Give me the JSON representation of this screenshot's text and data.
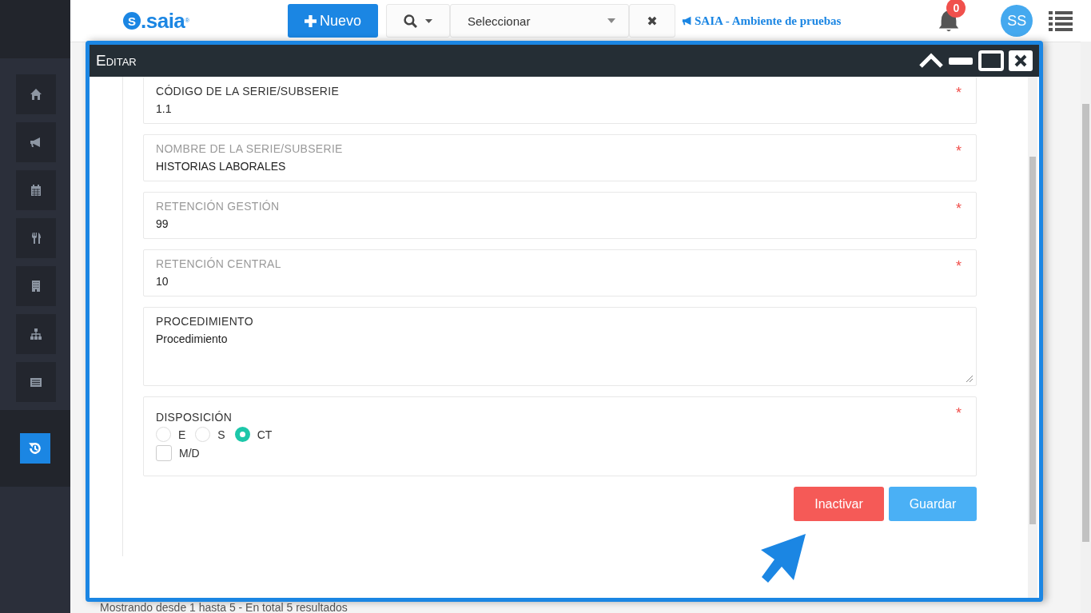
{
  "header": {
    "logo": {
      "badge": "S",
      "name": ".saia",
      "mark": "®"
    },
    "new_button": "Nuevo",
    "select": {
      "placeholder": "Seleccionar"
    },
    "clear_button": "✖",
    "announcement": "SAIA - Ambiente de pruebas",
    "notifications": {
      "count": "0"
    },
    "avatar": "SS"
  },
  "sidebar": {
    "items": [
      {
        "selected": false
      },
      {
        "selected": false
      },
      {
        "selected": false
      },
      {
        "selected": false
      },
      {
        "selected": false
      },
      {
        "selected": false
      },
      {
        "selected": false
      }
    ]
  },
  "dialog": {
    "title": "Editar",
    "fields": [
      {
        "kind": "text",
        "label": "CÓDIGO DE LA SERIE/SUBSERIE",
        "value": "1.1",
        "required_mark": "*",
        "disabled": false
      },
      {
        "kind": "text",
        "label": "NOMBRE DE LA SERIE/SUBSERIE",
        "value": "HISTORIAS LABORALES",
        "required_mark": "*",
        "disabled": true
      },
      {
        "kind": "text",
        "label": "RETENCIÓN GESTIÓN",
        "value": "99",
        "required_mark": "*",
        "disabled": true
      },
      {
        "kind": "text",
        "label": "RETENCIÓN CENTRAL",
        "value": "10",
        "required_mark": "*",
        "disabled": true
      },
      {
        "kind": "textarea",
        "label": "PROCEDIMIENTO",
        "value": "Procedimiento",
        "disabled": false
      },
      {
        "kind": "choice",
        "label": "DISPOSICIÓN",
        "required_mark": "*",
        "disabled": false,
        "options": [
          {
            "label": "E",
            "selected": false
          },
          {
            "label": "S",
            "selected": false
          },
          {
            "label": "CT",
            "selected": true
          }
        ],
        "checkbox": {
          "label": "M/D",
          "checked": false
        }
      }
    ],
    "buttons": [
      {
        "label": "Inactivar",
        "kind": "danger"
      },
      {
        "label": "Guardar",
        "kind": "primary"
      }
    ]
  },
  "footer": {
    "summary": "Mostrando desde 1 hasta 5 - En total 5 resultados"
  }
}
